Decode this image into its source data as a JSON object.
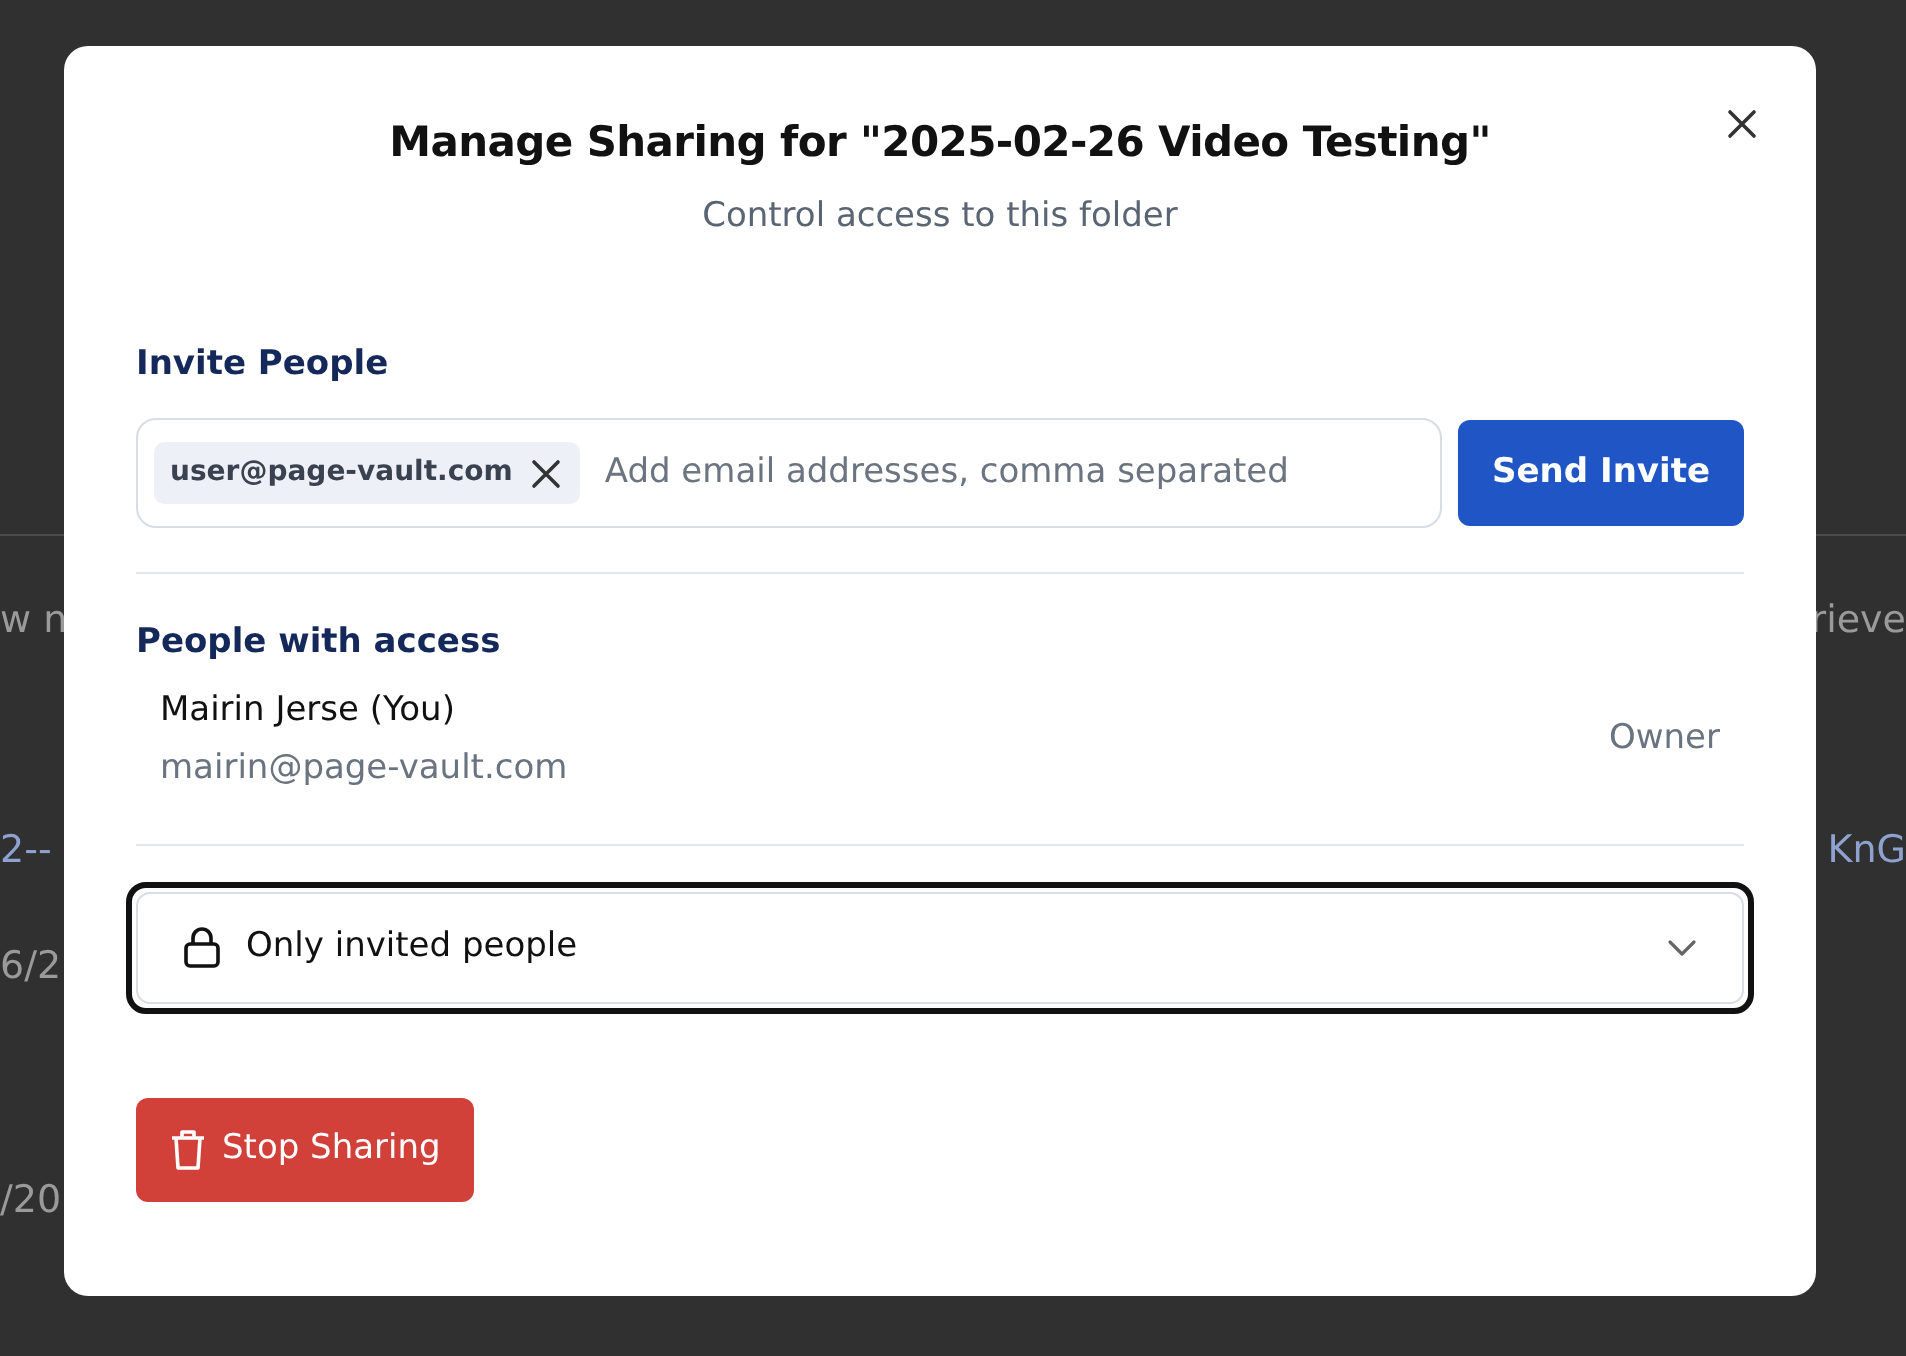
{
  "background": {
    "rows": [
      {
        "kind": "text",
        "left": "w n",
        "right": "rieve"
      },
      {
        "kind": "link",
        "left": "2--",
        "right": "KnG"
      },
      {
        "kind": "text",
        "left": "6/2"
      },
      {
        "kind": "text",
        "left": "/20"
      }
    ]
  },
  "dialog": {
    "title": "Manage Sharing for \"2025-02-26 Video Testing\"",
    "subtitle": "Control access to this folder",
    "invite": {
      "label": "Invite People",
      "chips": [
        "user@page-vault.com"
      ],
      "placeholder": "Add email addresses, comma separated",
      "button": "Send Invite"
    },
    "access": {
      "label": "People with access",
      "people": [
        {
          "name": "Mairin Jerse (You)",
          "email": "mairin@page-vault.com",
          "role": "Owner"
        }
      ]
    },
    "visibility": {
      "value": "Only invited people",
      "focused": true
    },
    "stop_button": "Stop Sharing"
  }
}
